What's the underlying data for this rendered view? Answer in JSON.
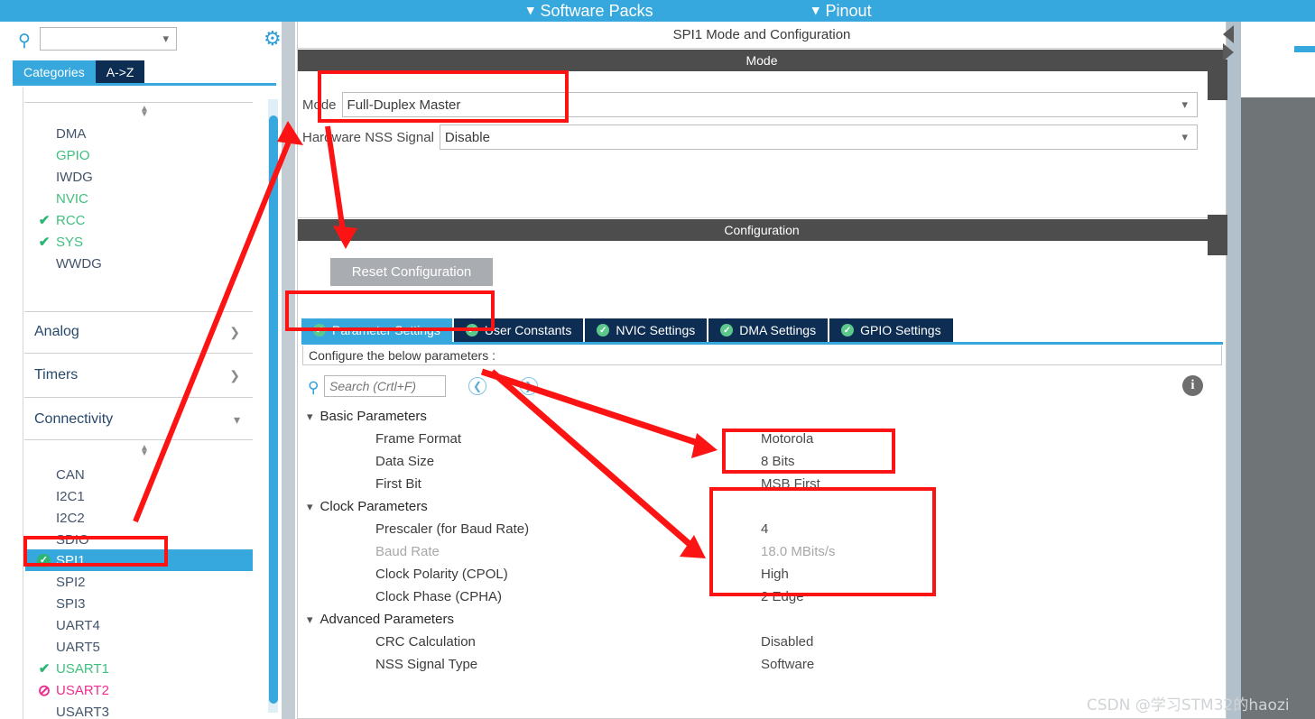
{
  "topbar": {
    "items": [
      {
        "label": "Software Packs",
        "icon": "chevron-down-icon"
      },
      {
        "label": "Pinout",
        "icon": "chevron-down-icon"
      }
    ]
  },
  "sidebar": {
    "search": {
      "value": "",
      "placeholder": ""
    },
    "gear_icon": "gear-icon",
    "tabs": [
      {
        "label": "Categories",
        "active": true
      },
      {
        "label": "A->Z",
        "active": false
      }
    ],
    "system_group": {
      "items": [
        {
          "label": "DMA",
          "status": "none",
          "color": "gray"
        },
        {
          "label": "GPIO",
          "status": "none",
          "color": "green"
        },
        {
          "label": "IWDG",
          "status": "none",
          "color": "gray"
        },
        {
          "label": "NVIC",
          "status": "none",
          "color": "green"
        },
        {
          "label": "RCC",
          "status": "check",
          "color": "green"
        },
        {
          "label": "SYS",
          "status": "check",
          "color": "green"
        },
        {
          "label": "WWDG",
          "status": "none",
          "color": "gray"
        }
      ]
    },
    "groups": [
      {
        "label": "Analog",
        "expanded": false,
        "chevron": "chevron-right-icon"
      },
      {
        "label": "Timers",
        "expanded": false,
        "chevron": "chevron-right-icon"
      },
      {
        "label": "Connectivity",
        "expanded": true,
        "chevron": "chevron-down-icon"
      }
    ],
    "connectivity_items": [
      {
        "label": "CAN",
        "status": "none",
        "color": "gray",
        "selected": false
      },
      {
        "label": "I2C1",
        "status": "none",
        "color": "gray",
        "selected": false
      },
      {
        "label": "I2C2",
        "status": "none",
        "color": "gray",
        "selected": false
      },
      {
        "label": "SDIO",
        "status": "none",
        "color": "gray",
        "selected": false
      },
      {
        "label": "SPI1",
        "status": "circlecheck",
        "color": "white",
        "selected": true
      },
      {
        "label": "SPI2",
        "status": "none",
        "color": "gray",
        "selected": false
      },
      {
        "label": "SPI3",
        "status": "none",
        "color": "gray",
        "selected": false
      },
      {
        "label": "UART4",
        "status": "none",
        "color": "gray",
        "selected": false
      },
      {
        "label": "UART5",
        "status": "none",
        "color": "gray",
        "selected": false
      },
      {
        "label": "USART1",
        "status": "check",
        "color": "green",
        "selected": false
      },
      {
        "label": "USART2",
        "status": "ban",
        "color": "pink",
        "selected": false
      },
      {
        "label": "USART3",
        "status": "none",
        "color": "gray",
        "selected": false
      }
    ]
  },
  "main": {
    "title": "SPI1 Mode and Configuration",
    "mode_section": {
      "header": "Mode",
      "fields": [
        {
          "label": "Mode",
          "value": "Full-Duplex Master"
        },
        {
          "label": "Hardware NSS Signal",
          "value": "Disable"
        }
      ]
    },
    "config_section": {
      "header": "Configuration",
      "reset_button": "Reset Configuration",
      "tabs": [
        {
          "label": "Parameter Settings",
          "active": true
        },
        {
          "label": "User Constants",
          "active": false
        },
        {
          "label": "NVIC Settings",
          "active": false
        },
        {
          "label": "DMA Settings",
          "active": false
        },
        {
          "label": "GPIO Settings",
          "active": false
        }
      ],
      "note": "Configure the below parameters :",
      "search": {
        "placeholder": "Search (Crtl+F)",
        "value": ""
      },
      "prev_icon": "chevron-left-circle-icon",
      "next_icon": "chevron-right-circle-icon",
      "info_icon": "info-icon",
      "parameters": [
        {
          "kind": "group",
          "label": "Basic Parameters",
          "expanded": true
        },
        {
          "kind": "param",
          "label": "Frame Format",
          "value": "Motorola",
          "dim": false
        },
        {
          "kind": "param",
          "label": "Data Size",
          "value": "8 Bits",
          "dim": false
        },
        {
          "kind": "param",
          "label": "First Bit",
          "value": "MSB First",
          "dim": false
        },
        {
          "kind": "group",
          "label": "Clock Parameters",
          "expanded": true
        },
        {
          "kind": "param",
          "label": "Prescaler (for Baud Rate)",
          "value": "4",
          "dim": false
        },
        {
          "kind": "param",
          "label": "Baud Rate",
          "value": "18.0 MBits/s",
          "dim": true
        },
        {
          "kind": "param",
          "label": "Clock Polarity (CPOL)",
          "value": "High",
          "dim": false
        },
        {
          "kind": "param",
          "label": "Clock Phase (CPHA)",
          "value": "2 Edge",
          "dim": false
        },
        {
          "kind": "group",
          "label": "Advanced Parameters",
          "expanded": true
        },
        {
          "kind": "param",
          "label": "CRC Calculation",
          "value": "Disabled",
          "dim": false
        },
        {
          "kind": "param",
          "label": "NSS Signal Type",
          "value": "Software",
          "dim": false
        }
      ]
    }
  },
  "watermark": {
    "text": "CSDN @学习STM32的haozi"
  },
  "annotation": {
    "color": "#fc1414"
  }
}
